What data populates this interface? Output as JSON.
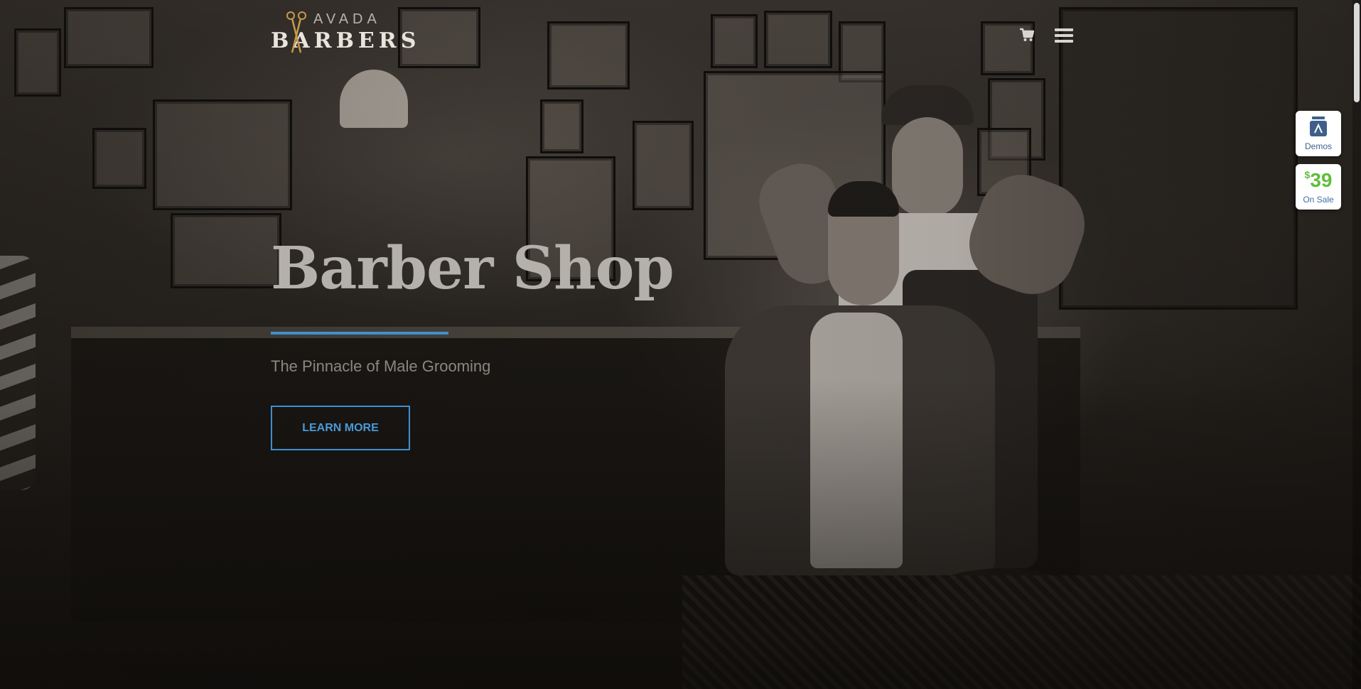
{
  "header": {
    "logo_top": "AVADA",
    "logo_bottom": "BARBERS",
    "cart_icon": "shopping-cart-icon",
    "menu_icon": "hamburger-menu-icon"
  },
  "hero": {
    "title": "Barber Shop",
    "subtitle": "The Pinnacle of Male Grooming",
    "button_label": "LEARN MORE"
  },
  "side_panel": {
    "demos_label": "Demos",
    "price_currency": "$",
    "price_value": "39",
    "sale_label": "On Sale"
  },
  "colors": {
    "accent": "#3f8fcf",
    "price_green": "#5fbf3b",
    "logo_gold": "#c89a4a"
  }
}
